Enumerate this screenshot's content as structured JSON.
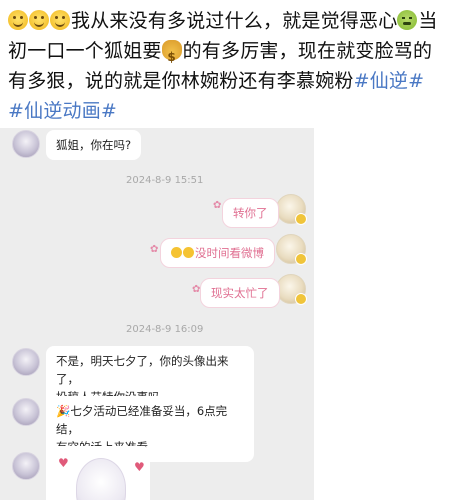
{
  "post": {
    "line1": "我从来没有多说过什么，就是觉得恶心",
    "line1_end": "当",
    "line2_a": "初一口一个狐姐要",
    "line2_b": "的有多厉害，现在就变脸骂的",
    "line3_a": "有多狠，说的就是你林婉粉还有李慕婉粉",
    "tag1": "#仙逆#",
    "tag2": "#仙逆动画#",
    "emojis": [
      "slightly-smiling-face-icon",
      "slightly-smiling-face-icon",
      "slightly-smiling-face-icon",
      "nauseated-face-icon",
      "money-bag-icon"
    ]
  },
  "chat": {
    "messages": [
      {
        "side": "left",
        "text": "狐姐，你在吗?"
      },
      {
        "side": "right",
        "text": "转你了"
      },
      {
        "side": "right",
        "text": "没时间看微博"
      },
      {
        "side": "right",
        "text": "现实太忙了"
      },
      {
        "side": "left",
        "text": "不是，明天七夕了，你的头像出来了，投稿人艾特你没事吗"
      },
      {
        "side": "left",
        "text": "七夕活动已经准备妥当，6点完结，有空的话上来准看"
      }
    ],
    "timestamps": [
      "2024-8-9 15:51",
      "2024-8-9 16:09"
    ],
    "msg5_line1": "不是，明天七夕了，你的头像出来了，",
    "msg5_line2": "投稿人艾特你没事吗",
    "msg6_line1": "七夕活动已经准备妥当，6点完结，",
    "msg6_line2": "有空的话上来准看"
  },
  "colors": {
    "tag": "#4a78c4",
    "chat_bg": "#ededed",
    "right_bubble_text": "#e07092"
  }
}
